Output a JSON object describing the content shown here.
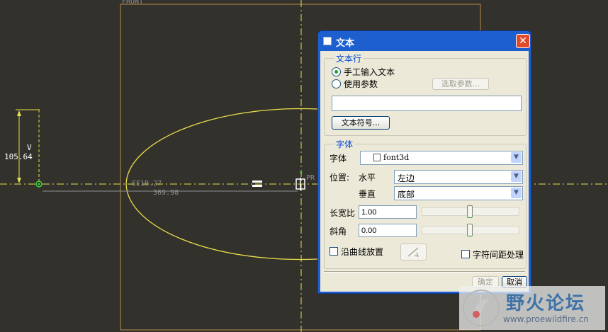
{
  "canvas": {
    "front_label": "FRONT",
    "dim_v_label": "V",
    "dim_v_value": "105.64",
    "dim_h_value": "369.98",
    "frag_text_1": "EE1B.27",
    "frag_text_2": "PR"
  },
  "dialog": {
    "title": "文本",
    "close_icon": "close-icon",
    "text_line_group": "文本行",
    "radio_manual": "手工输入文本",
    "radio_param": "使用参数",
    "select_param_button": "选取参数...",
    "text_input_value": "",
    "text_symbol_button": "文本符号...",
    "font_group": "字体",
    "font_label": "字体",
    "font_value": "font3d",
    "position_label": "位置:",
    "horizontal_label": "水平",
    "horizontal_value": "左边",
    "vertical_label": "垂直",
    "vertical_value": "底部",
    "aspect_label": "长宽比",
    "aspect_value": "1.00",
    "slant_label": "斜角",
    "slant_value": "0.00",
    "along_curve_label": "沿曲线放置",
    "char_spacing_label": "字符间距处理",
    "ok_button": "确定",
    "cancel_button": "取消"
  },
  "watermark": {
    "title": "野火论坛",
    "url": "www.proewildfire.cn"
  },
  "colors": {
    "background": "#33312c",
    "sketch_yellow": "#e8e04a",
    "frame_orange": "#b98a4a",
    "dialog_blue": "#1d5fcf",
    "dialog_face": "#ece9d8",
    "group_text": "#0046d5"
  }
}
